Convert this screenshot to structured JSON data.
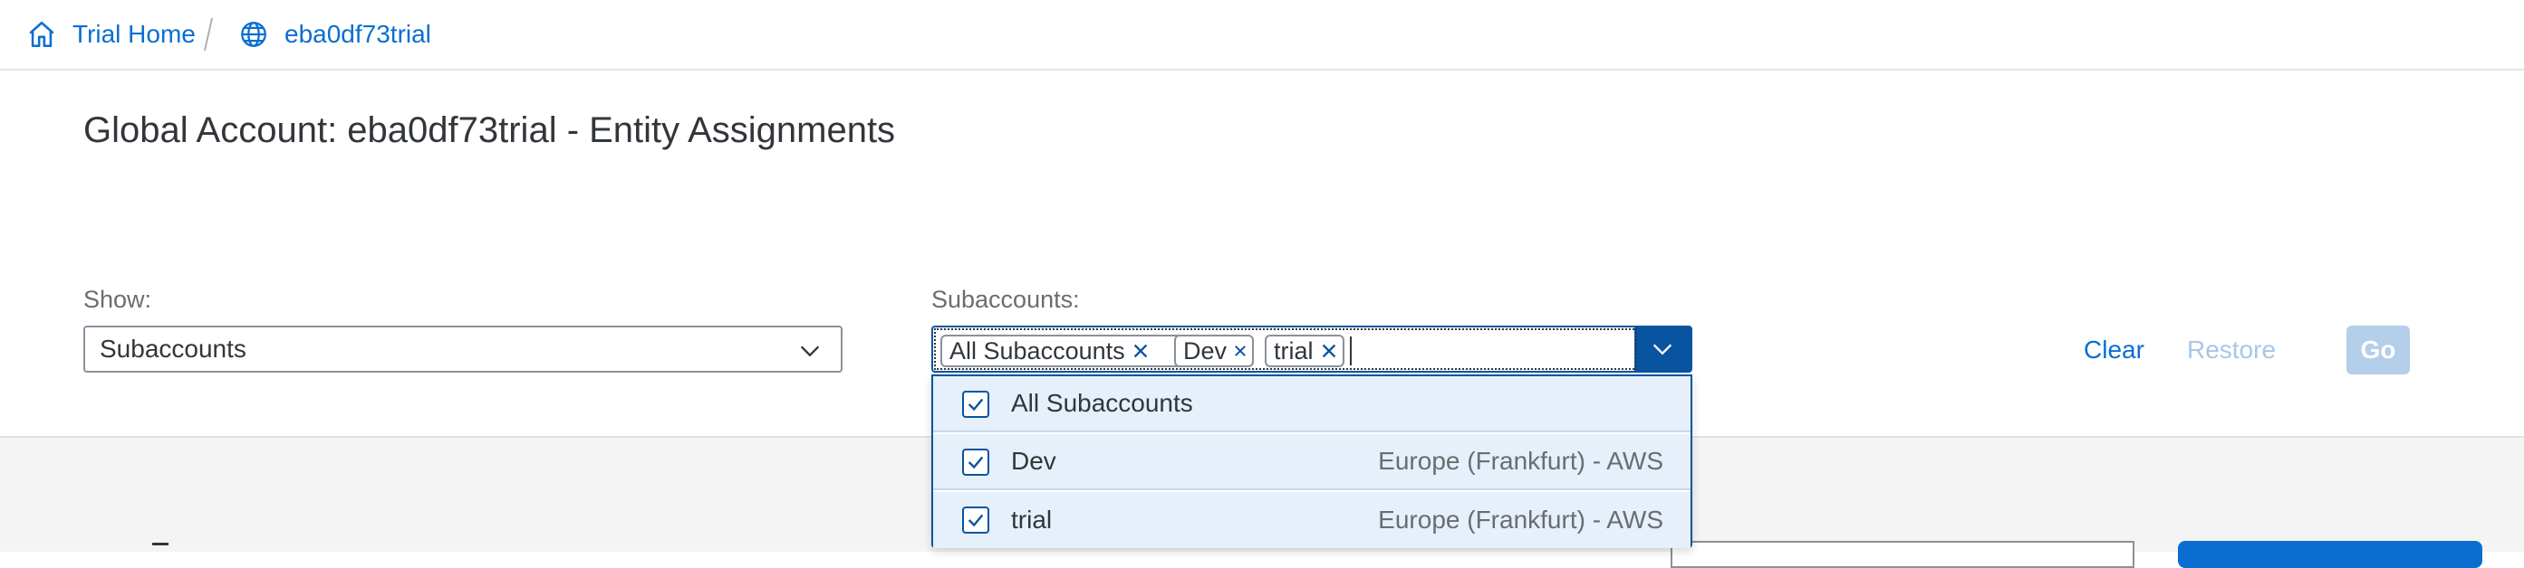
{
  "breadcrumb": {
    "home_label": "Trial Home",
    "account_label": "eba0df73trial"
  },
  "page": {
    "title": "Global Account: eba0df73trial - Entity Assignments"
  },
  "filters": {
    "show_label": "Show:",
    "show_value": "Subaccounts",
    "subaccounts_label": "Subaccounts:",
    "tokens": [
      "All Subaccounts",
      "Dev",
      "trial"
    ],
    "clear_label": "Clear",
    "restore_label": "Restore",
    "go_label": "Go"
  },
  "dropdown": {
    "options": [
      {
        "label": "All Subaccounts",
        "region": "",
        "checked": true
      },
      {
        "label": "Dev",
        "region": "Europe (Frankfurt) - AWS",
        "checked": true
      },
      {
        "label": "trial",
        "region": "Europe (Frankfurt) - AWS",
        "checked": true
      }
    ]
  },
  "colors": {
    "link": "#0a6ed1",
    "accent": "#0854a0",
    "disabled_link": "#a7c7e8",
    "disabled_button": "#b3cfe9",
    "selected_row": "#e5f0fa"
  }
}
